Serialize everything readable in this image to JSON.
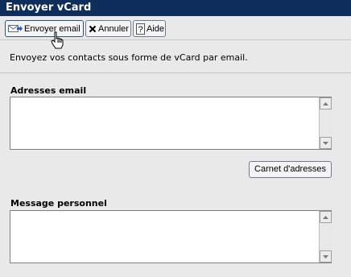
{
  "window": {
    "title": "Envoyer vCard"
  },
  "toolbar": {
    "send_label": "Envoyer email",
    "cancel_label": "Annuler",
    "help_label": "Aide"
  },
  "description": "Envoyez vos contacts sous forme de vCard par email.",
  "email_field": {
    "label": "Adresses email",
    "value": ""
  },
  "address_book_button": "Carnet d'adresses",
  "message_field": {
    "label": "Message personnel",
    "value": ""
  }
}
